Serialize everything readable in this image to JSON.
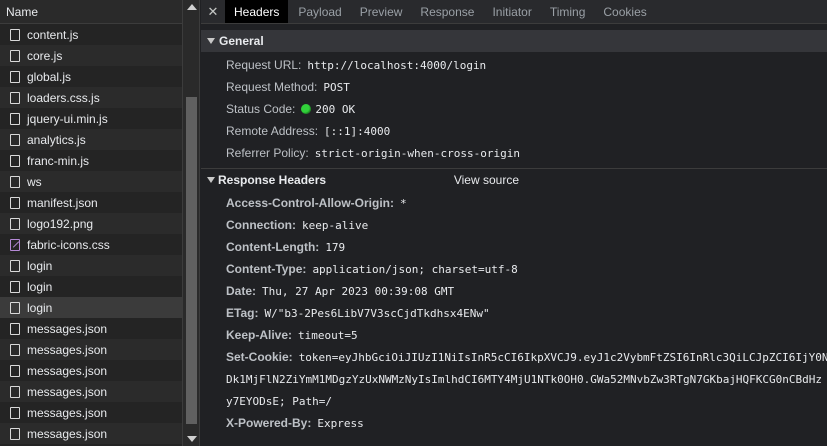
{
  "file_list": {
    "header": "Name",
    "rows": [
      {
        "name": "content.js",
        "icon": "file-icon"
      },
      {
        "name": "core.js",
        "icon": "file-icon"
      },
      {
        "name": "global.js",
        "icon": "file-icon"
      },
      {
        "name": "loaders.css.js",
        "icon": "file-icon"
      },
      {
        "name": "jquery-ui.min.js",
        "icon": "file-icon"
      },
      {
        "name": "analytics.js",
        "icon": "file-icon"
      },
      {
        "name": "franc-min.js",
        "icon": "file-icon"
      },
      {
        "name": "ws",
        "icon": "file-icon"
      },
      {
        "name": "manifest.json",
        "icon": "file-icon"
      },
      {
        "name": "logo192.png",
        "icon": "file-icon"
      },
      {
        "name": "fabric-icons.css",
        "icon": "stylesheet-icon"
      },
      {
        "name": "login",
        "icon": "file-icon"
      },
      {
        "name": "login",
        "icon": "file-icon"
      },
      {
        "name": "login",
        "icon": "file-icon",
        "selected": true
      },
      {
        "name": "messages.json",
        "icon": "file-icon"
      },
      {
        "name": "messages.json",
        "icon": "file-icon"
      },
      {
        "name": "messages.json",
        "icon": "file-icon"
      },
      {
        "name": "messages.json",
        "icon": "file-icon"
      },
      {
        "name": "messages.json",
        "icon": "file-icon"
      },
      {
        "name": "messages.json",
        "icon": "file-icon"
      }
    ]
  },
  "tabs": {
    "close": "✕",
    "items": [
      "Headers",
      "Payload",
      "Preview",
      "Response",
      "Initiator",
      "Timing",
      "Cookies"
    ],
    "active": "Headers"
  },
  "general": {
    "title": "General",
    "request_url_k": "Request URL:",
    "request_url_v": "http://localhost:4000/login",
    "request_method_k": "Request Method:",
    "request_method_v": "POST",
    "status_code_k": "Status Code:",
    "status_code_v": "200 OK",
    "remote_address_k": "Remote Address:",
    "remote_address_v": "[::1]:4000",
    "referrer_policy_k": "Referrer Policy:",
    "referrer_policy_v": "strict-origin-when-cross-origin"
  },
  "response_headers": {
    "title": "Response Headers",
    "view_source": "View source",
    "acao_k": "Access-Control-Allow-Origin:",
    "acao_v": "*",
    "connection_k": "Connection:",
    "connection_v": "keep-alive",
    "content_length_k": "Content-Length:",
    "content_length_v": "179",
    "content_type_k": "Content-Type:",
    "content_type_v": "application/json; charset=utf-8",
    "date_k": "Date:",
    "date_v": "Thu, 27 Apr 2023 00:39:08 GMT",
    "etag_k": "ETag:",
    "etag_v": "W/\"b3-2Pes6LibV7V3scCjdTkdhsx4ENw\"",
    "keep_alive_k": "Keep-Alive:",
    "keep_alive_v": "timeout=5",
    "set_cookie_k": "Set-Cookie:",
    "set_cookie_v1": "token=eyJhbGciOiJIUzI1NiIsInR5cCI6IkpXVCJ9.eyJ1c2VybmFtZSI6InRlc3QiLCJpZCI6IjY0N",
    "set_cookie_v2": "Dk1MjFlN2ZiYmM1MDgzYzUxNWMzNyIsImlhdCI6MTY4MjU1NTk0OH0.GWa52MNvbZw3RTgN7GKbajHQFKCG0nCBdHz",
    "set_cookie_v3": "y7EYODsE; Path=/",
    "x_powered_by_k": "X-Powered-By:",
    "x_powered_by_v": "Express"
  },
  "colors": {
    "status_ok": "#31d13a",
    "active_tab_bg": "#000000",
    "stylesheet_icon": "#b58ad6"
  }
}
